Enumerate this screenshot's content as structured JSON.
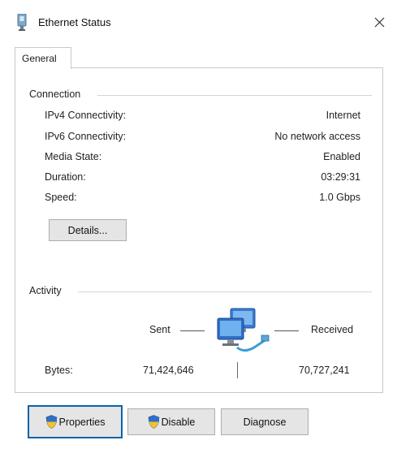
{
  "window": {
    "title": "Ethernet Status",
    "close_glyph": "✕"
  },
  "tabs": [
    {
      "label": "General",
      "selected": true
    }
  ],
  "connection": {
    "heading": "Connection",
    "rows": [
      {
        "label": "IPv4 Connectivity:",
        "value": "Internet"
      },
      {
        "label": "IPv6 Connectivity:",
        "value": "No network access"
      },
      {
        "label": "Media State:",
        "value": "Enabled"
      },
      {
        "label": "Duration:",
        "value": "03:29:31"
      },
      {
        "label": "Speed:",
        "value": "1.0 Gbps"
      }
    ],
    "details_button": "Details..."
  },
  "activity": {
    "heading": "Activity",
    "sent_label": "Sent",
    "received_label": "Received",
    "bytes_label": "Bytes:",
    "bytes_sent": "71,424,646",
    "bytes_received": "70,727,241"
  },
  "buttons": {
    "properties": "Properties",
    "disable": "Disable",
    "diagnose": "Diagnose"
  },
  "icons": {
    "title": "ethernet-adapter-icon",
    "activity": "network-computers-icon",
    "shield": "uac-shield-icon"
  },
  "colors": {
    "focus_outline": "#0a64a8",
    "button_face": "#e5e5e5",
    "border": "#c9c9c9"
  }
}
